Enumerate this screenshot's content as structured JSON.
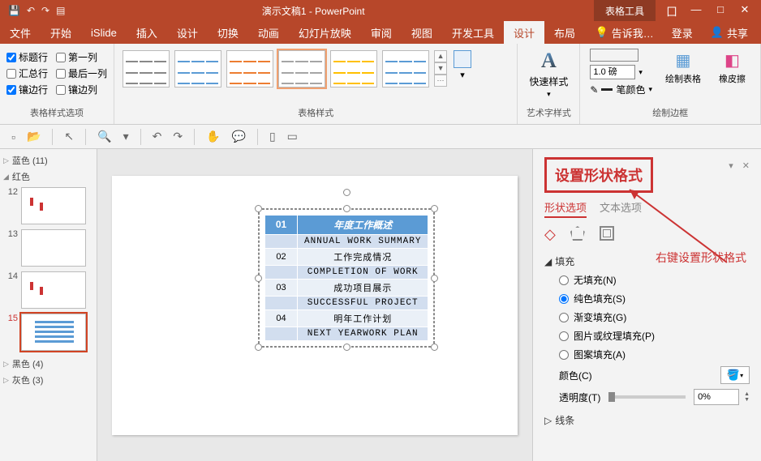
{
  "titlebar": {
    "title": "演示文稿1 - PowerPoint",
    "context_tab": "表格工具"
  },
  "window_controls": {
    "ribbon_opts": "囗",
    "min": "—",
    "restore": "□",
    "close": "✕"
  },
  "tabs": {
    "file": "文件",
    "home": "开始",
    "islide": "iSlide",
    "insert": "插入",
    "design": "设计",
    "transition": "切换",
    "animation": "动画",
    "slideshow": "幻灯片放映",
    "review": "审阅",
    "view": "视图",
    "developer": "开发工具",
    "table_design": "设计",
    "table_layout": "布局"
  },
  "ribbon_right": {
    "tell_me": "告诉我…",
    "login": "登录",
    "share": "共享"
  },
  "groups": {
    "style_options": {
      "title": "表格样式选项",
      "header_row": "标题行",
      "first_col": "第一列",
      "total_row": "汇总行",
      "last_col": "最后一列",
      "banded_row": "镶边行",
      "banded_col": "镶边列"
    },
    "table_styles": {
      "title": "表格样式",
      "shading": "底纹",
      "quick_style": "快速样式"
    },
    "wordart": {
      "title": "艺术字样式",
      "quick": "快速样式"
    },
    "borders": {
      "title": "绘制边框",
      "weight": "1.0 磅",
      "pen": "笔颜色",
      "draw": "绘制表格",
      "eraser": "橡皮擦"
    }
  },
  "thumbs": {
    "blue": "蓝色 (11)",
    "red": "红色",
    "black": "黑色 (4)",
    "gray": "灰色 (3)",
    "nums": [
      "12",
      "13",
      "14",
      "15"
    ]
  },
  "table": {
    "h1": "01",
    "h2": "年度工作概述",
    "rows": [
      [
        "",
        "ANNUAL WORK SUMMARY"
      ],
      [
        "02",
        "工作完成情况"
      ],
      [
        "",
        "COMPLETION OF WORK"
      ],
      [
        "03",
        "成功项目展示"
      ],
      [
        "",
        "SUCCESSFUL PROJECT"
      ],
      [
        "04",
        "明年工作计划"
      ],
      [
        "",
        "NEXT YEARWORK PLAN"
      ]
    ]
  },
  "pane": {
    "title": "设置形状格式",
    "tab_shape": "形状选项",
    "tab_text": "文本选项",
    "fill": "填充",
    "no_fill": "无填充(N)",
    "solid": "纯色填充(S)",
    "gradient": "渐变填充(G)",
    "picture": "图片或纹理填充(P)",
    "pattern": "图案填充(A)",
    "color": "颜色(C)",
    "transparency": "透明度(T)",
    "trans_val": "0%",
    "line": "线条",
    "annotation": "右键设置形状格式"
  }
}
